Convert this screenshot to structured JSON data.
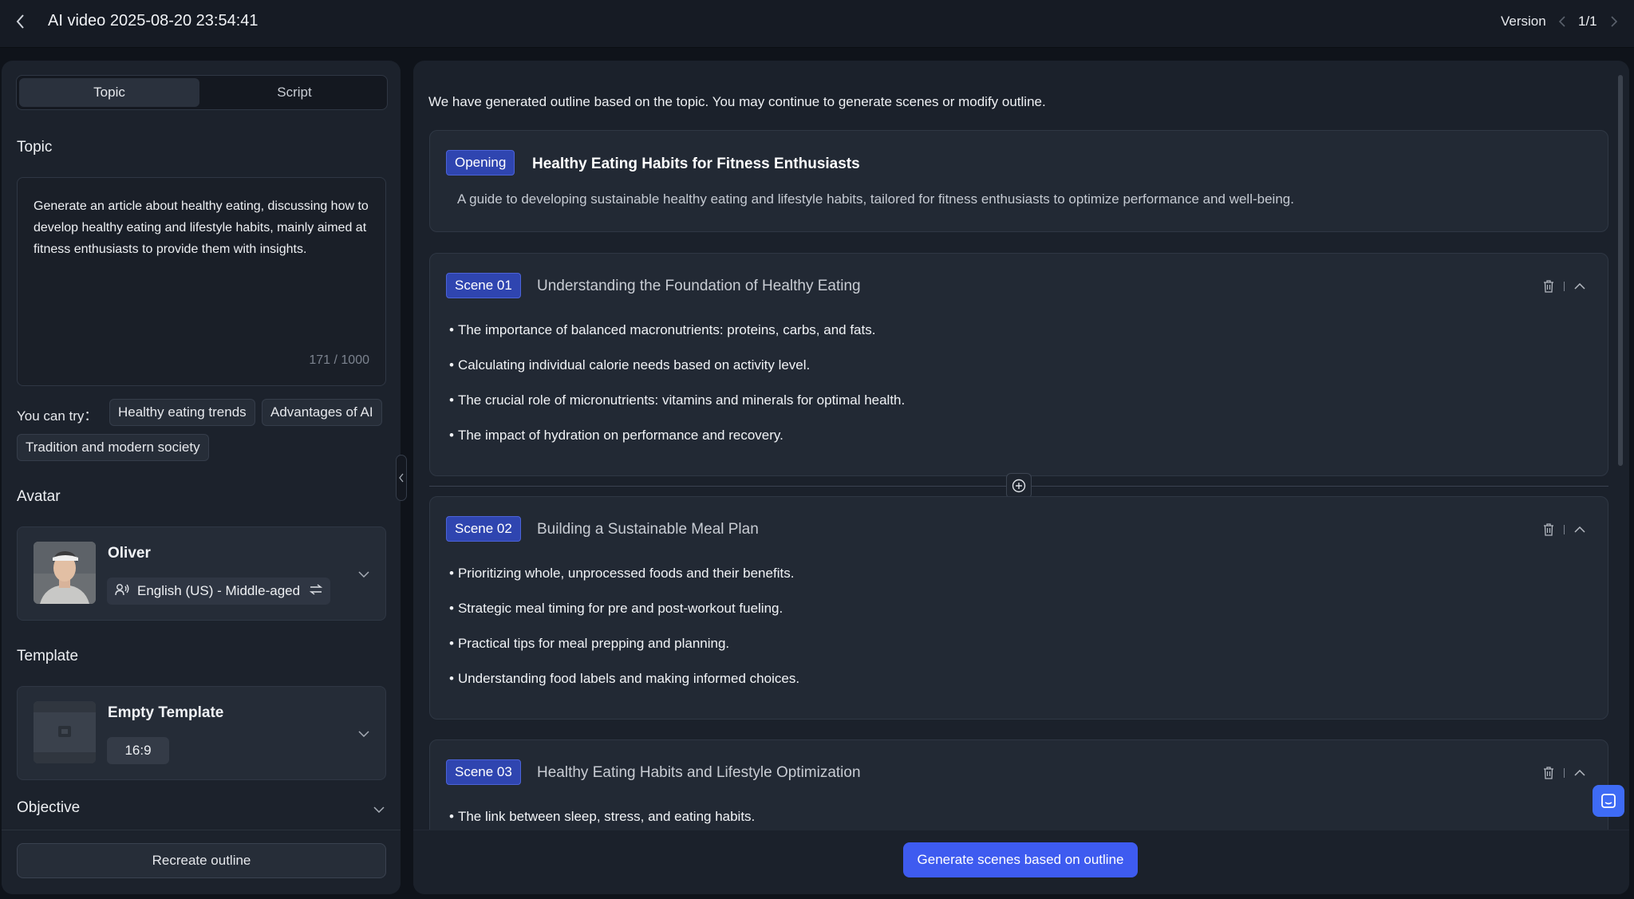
{
  "header": {
    "title": "AI video 2025-08-20 23:54:41",
    "version_label": "Version",
    "version_count": "1/1"
  },
  "left": {
    "tabs": [
      {
        "label": "Topic",
        "active": true
      },
      {
        "label": "Script",
        "active": false
      }
    ],
    "topic": {
      "label": "Topic",
      "text": "Generate an article about healthy eating, discussing how to develop healthy eating and lifestyle habits, mainly aimed at fitness enthusiasts to provide them with insights.",
      "char_count": "171 / 1000"
    },
    "suggestions": {
      "label": "You can try：",
      "items": [
        "Healthy eating trends",
        "Advantages of AI",
        "Tradition and modern society"
      ]
    },
    "avatar": {
      "label": "Avatar",
      "name": "Oliver",
      "voice": "English (US) - Middle-aged"
    },
    "template": {
      "label": "Template",
      "name": "Empty Template",
      "ratio": "16:9"
    },
    "objective": {
      "label": "Objective"
    },
    "recreate_label": "Recreate outline"
  },
  "main": {
    "intro": "We have generated outline based on the topic. You may continue to generate scenes or modify outline.",
    "opening": {
      "badge": "Opening",
      "title": "Healthy Eating Habits for Fitness Enthusiasts",
      "description": "A guide to developing sustainable healthy eating and lifestyle habits, tailored for fitness enthusiasts to optimize performance and well-being."
    },
    "scenes": [
      {
        "badge": "Scene 01",
        "title": "Understanding the Foundation of Healthy Eating",
        "bullets": [
          "The importance of balanced macronutrients: proteins, carbs, and fats.",
          "Calculating individual calorie needs based on activity level.",
          "The crucial role of micronutrients: vitamins and minerals for optimal health.",
          "The impact of hydration on performance and recovery."
        ]
      },
      {
        "badge": "Scene 02",
        "title": "Building a Sustainable Meal Plan",
        "bullets": [
          "Prioritizing whole, unprocessed foods and their benefits.",
          "Strategic meal timing for pre and post-workout fueling.",
          "Practical tips for meal prepping and planning.",
          "Understanding food labels and making informed choices."
        ]
      },
      {
        "badge": "Scene 03",
        "title": "Healthy Eating Habits and Lifestyle Optimization",
        "bullets": [
          "The link between sleep, stress, and eating habits."
        ]
      }
    ],
    "bullet_char": "•",
    "generate_label": "Generate scenes based on outline"
  },
  "colors": {
    "accent": "#3e5bf0",
    "badge": "#2f45b0",
    "background": "#0f131a"
  },
  "icons": [
    "back-chevron-icon",
    "chevron-left-icon",
    "chevron-right-icon",
    "voice-user-icon",
    "swap-icon",
    "chevron-down-icon",
    "trash-icon",
    "chevron-up-icon",
    "plus-circle-icon",
    "collapse-chevron-icon",
    "chat-icon",
    "template-placeholder-icon"
  ]
}
